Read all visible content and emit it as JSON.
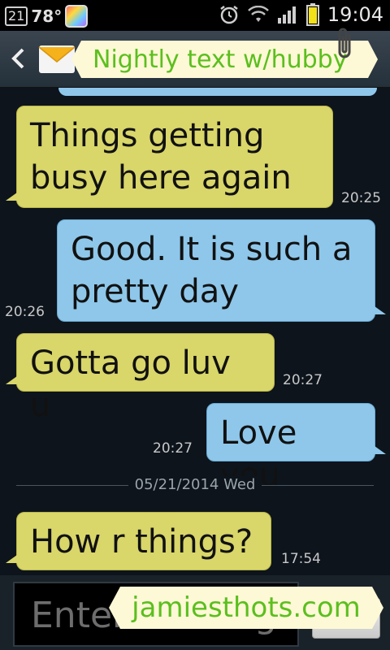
{
  "status_bar": {
    "notification_count": "21",
    "temperature": "78°",
    "time": "19:04",
    "icons": [
      "notification-badge-icon",
      "weather-app-icon",
      "alarm-icon",
      "wifi-icon",
      "signal-icon",
      "battery-icon"
    ]
  },
  "header": {
    "title": "Nightly text w/hubby",
    "back_icon": "chevron-left-icon",
    "message_icon": "envelope-icon"
  },
  "messages": [
    {
      "direction": "in",
      "text_line1": "Things getting",
      "text_line2": "busy here again",
      "time": "20:25"
    },
    {
      "direction": "out",
      "text_line1": "Good. It is such a",
      "text_line2": "pretty day",
      "time": "20:26"
    },
    {
      "direction": "in",
      "text_line1": "Gotta go luv u",
      "time": "20:27"
    },
    {
      "direction": "out",
      "text_line1": "Love you",
      "time": "20:27"
    },
    {
      "direction": "in",
      "text_line1": "How r things?",
      "time": "17:54"
    }
  ],
  "date_separator": "05/21/2014 Wed",
  "input": {
    "placeholder": "Enter message"
  },
  "watermark": "jamiesthots.com",
  "colors": {
    "incoming_bubble": "#d9d66a",
    "outgoing_bubble": "#8ec7ea",
    "title_green": "#5bbf1e",
    "background": "#0d141c"
  }
}
